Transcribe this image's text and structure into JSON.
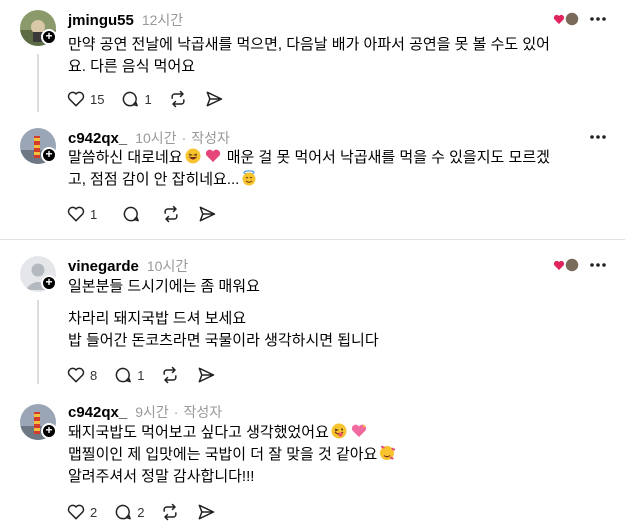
{
  "comments": [
    {
      "username": "jmingu55",
      "time": "12시간",
      "lines": [
        "만약 공연 전날에 낙곱새를 먹으면, 다음날 배가 아파서 공연을 못 볼 수도 있어",
        "요. 다른 음식 먹어요"
      ],
      "likes": "15",
      "replies": "1",
      "author_liked": true
    },
    {
      "username": "c942qx_",
      "time": "10시간",
      "author_tag": "작성자",
      "lines": [
        "말씀하신 대로네요",
        "매운 걸 못 먹어서 낙곱새를 먹을 수 있을지도 모르겠",
        "고, 점점 감이 안 잡히네요..."
      ],
      "likes": "1"
    },
    {
      "username": "vinegarde",
      "time": "10시간",
      "lines": [
        "일본분들 드시기에는 좀 매워요",
        "",
        "차라리 돼지국밥 드셔 보세요",
        "밥 들어간 돈코츠라면 국물이라 생각하시면 됩니다"
      ],
      "likes": "8",
      "replies": "1",
      "author_liked": true
    },
    {
      "username": "c942qx_",
      "time": "9시간",
      "author_tag": "작성자",
      "lines": [
        "돼지국밥도 먹어보고 싶다고 생각했었어요",
        "맵찔이인 제 입맛에는 국밥이 더 잘 맞을 것 같아요",
        "알려주셔서 정말 감사합니다!!!"
      ],
      "likes": "2",
      "replies": "2"
    }
  ],
  "icons": {
    "like": "heart-outline-icon",
    "reply": "speech-bubble-icon",
    "repost": "repost-icon",
    "share": "send-icon",
    "more": "more-dots-icon"
  }
}
